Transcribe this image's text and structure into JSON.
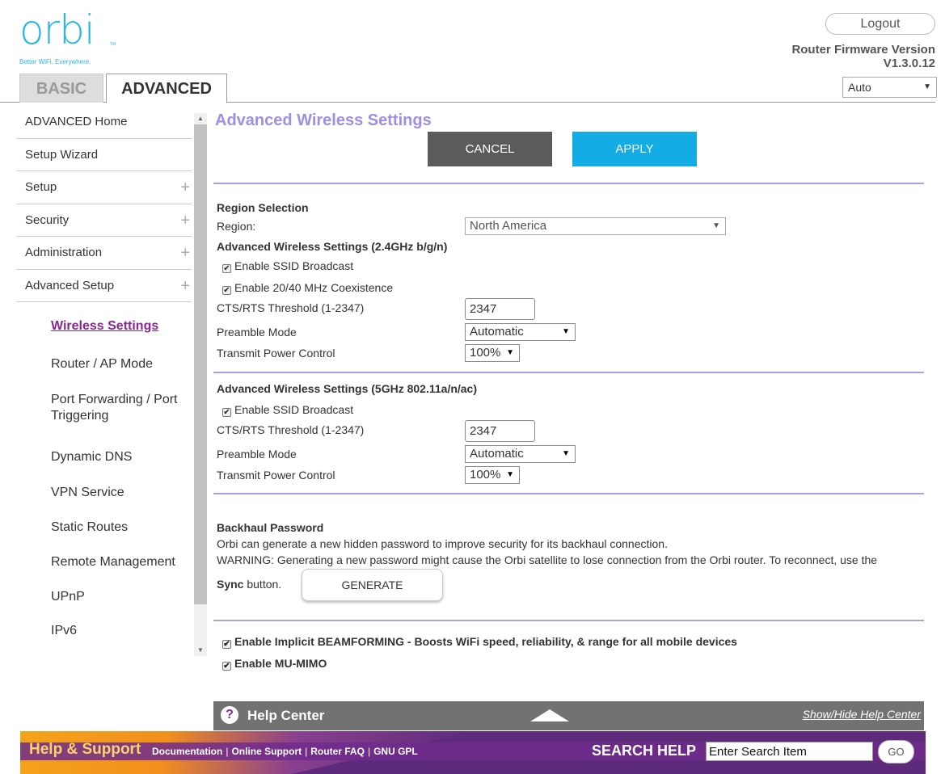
{
  "logo": {
    "wordmark": "orbi",
    "tm": "TM",
    "tagline": "Better WiFi. Everywhere."
  },
  "header": {
    "logout_label": "Logout",
    "firmware_label": "Router Firmware Version",
    "firmware_version": "V1.3.0.12",
    "language_value": "Auto"
  },
  "tabs": {
    "basic": "BASIC",
    "advanced": "ADVANCED"
  },
  "sidebar": {
    "main_items": [
      {
        "label": "ADVANCED Home"
      },
      {
        "label": "Setup Wizard"
      },
      {
        "label": "Setup",
        "expand": "+"
      },
      {
        "label": "Security",
        "expand": "+"
      },
      {
        "label": "Administration",
        "expand": "+"
      },
      {
        "label": "Advanced Setup",
        "expand": "+"
      }
    ],
    "sub_items": [
      {
        "label": "Wireless Settings",
        "active": true
      },
      {
        "label": "Router / AP Mode"
      },
      {
        "label": "Port Forwarding / Port Triggering"
      },
      {
        "label": "Dynamic DNS"
      },
      {
        "label": "VPN Service"
      },
      {
        "label": "Static Routes"
      },
      {
        "label": "Remote Management"
      },
      {
        "label": "UPnP"
      },
      {
        "label": "IPv6"
      }
    ]
  },
  "main": {
    "title": "Advanced Wireless Settings",
    "cancel_label": "CANCEL",
    "apply_label": "APPLY",
    "region": {
      "section": "Region Selection",
      "label": "Region:",
      "value": "North America"
    },
    "band_24": {
      "section": "Advanced Wireless Settings (2.4GHz b/g/n)",
      "ssid_broadcast": "Enable SSID Broadcast",
      "coexistence": "Enable 20/40 MHz Coexistence",
      "cts_label": "CTS/RTS Threshold (1-2347)",
      "cts_value": "2347",
      "preamble_label": "Preamble Mode",
      "preamble_value": "Automatic",
      "power_label": "Transmit Power Control",
      "power_value": "100%"
    },
    "band_5": {
      "section": "Advanced Wireless Settings (5GHz 802.11a/n/ac)",
      "ssid_broadcast": "Enable SSID Broadcast",
      "cts_label": "CTS/RTS Threshold (1-2347)",
      "cts_value": "2347",
      "preamble_label": "Preamble Mode",
      "preamble_value": "Automatic",
      "power_label": "Transmit Power Control",
      "power_value": "100%"
    },
    "backhaul": {
      "section": "Backhaul Password",
      "description": "Orbi can generate a new hidden password to improve security for its backhaul connection.",
      "warning": "WARNING: Generating a new password might cause the Orbi satellite to lose connection from the Orbi router. To reconnect, use the",
      "sync_bold": "Sync",
      "sync_rest": " button.",
      "generate_label": "GENERATE"
    },
    "beamforming": "Enable Implicit BEAMFORMING - Boosts WiFi speed, reliability, & range for all mobile devices",
    "mu_mimo": "Enable MU-MIMO"
  },
  "help_center": {
    "icon": "?",
    "title": "Help Center",
    "toggle": "Show/Hide Help Center"
  },
  "footer": {
    "title": "Help & Support",
    "links": [
      "Documentation",
      "Online Support",
      "Router FAQ",
      "GNU GPL"
    ],
    "search_label": "SEARCH HELP",
    "search_value": "Enter Search Item",
    "go_label": "GO"
  },
  "icons": {
    "checkbox_checked": "check-icon",
    "expand": "plus-icon",
    "dropdown": "caret-down-icon",
    "help": "question-circle-icon",
    "collapse": "arrow-up-icon"
  },
  "colors": {
    "accent_purple": "#8a2592",
    "title_lavender": "#9d8fe5",
    "apply_blue": "#13ace5",
    "cancel_gray": "#5b5b5b",
    "logo_blue": "#2cb5e0",
    "footer_purple": "#5d2a7c",
    "footer_orange": "#f5a31b"
  }
}
